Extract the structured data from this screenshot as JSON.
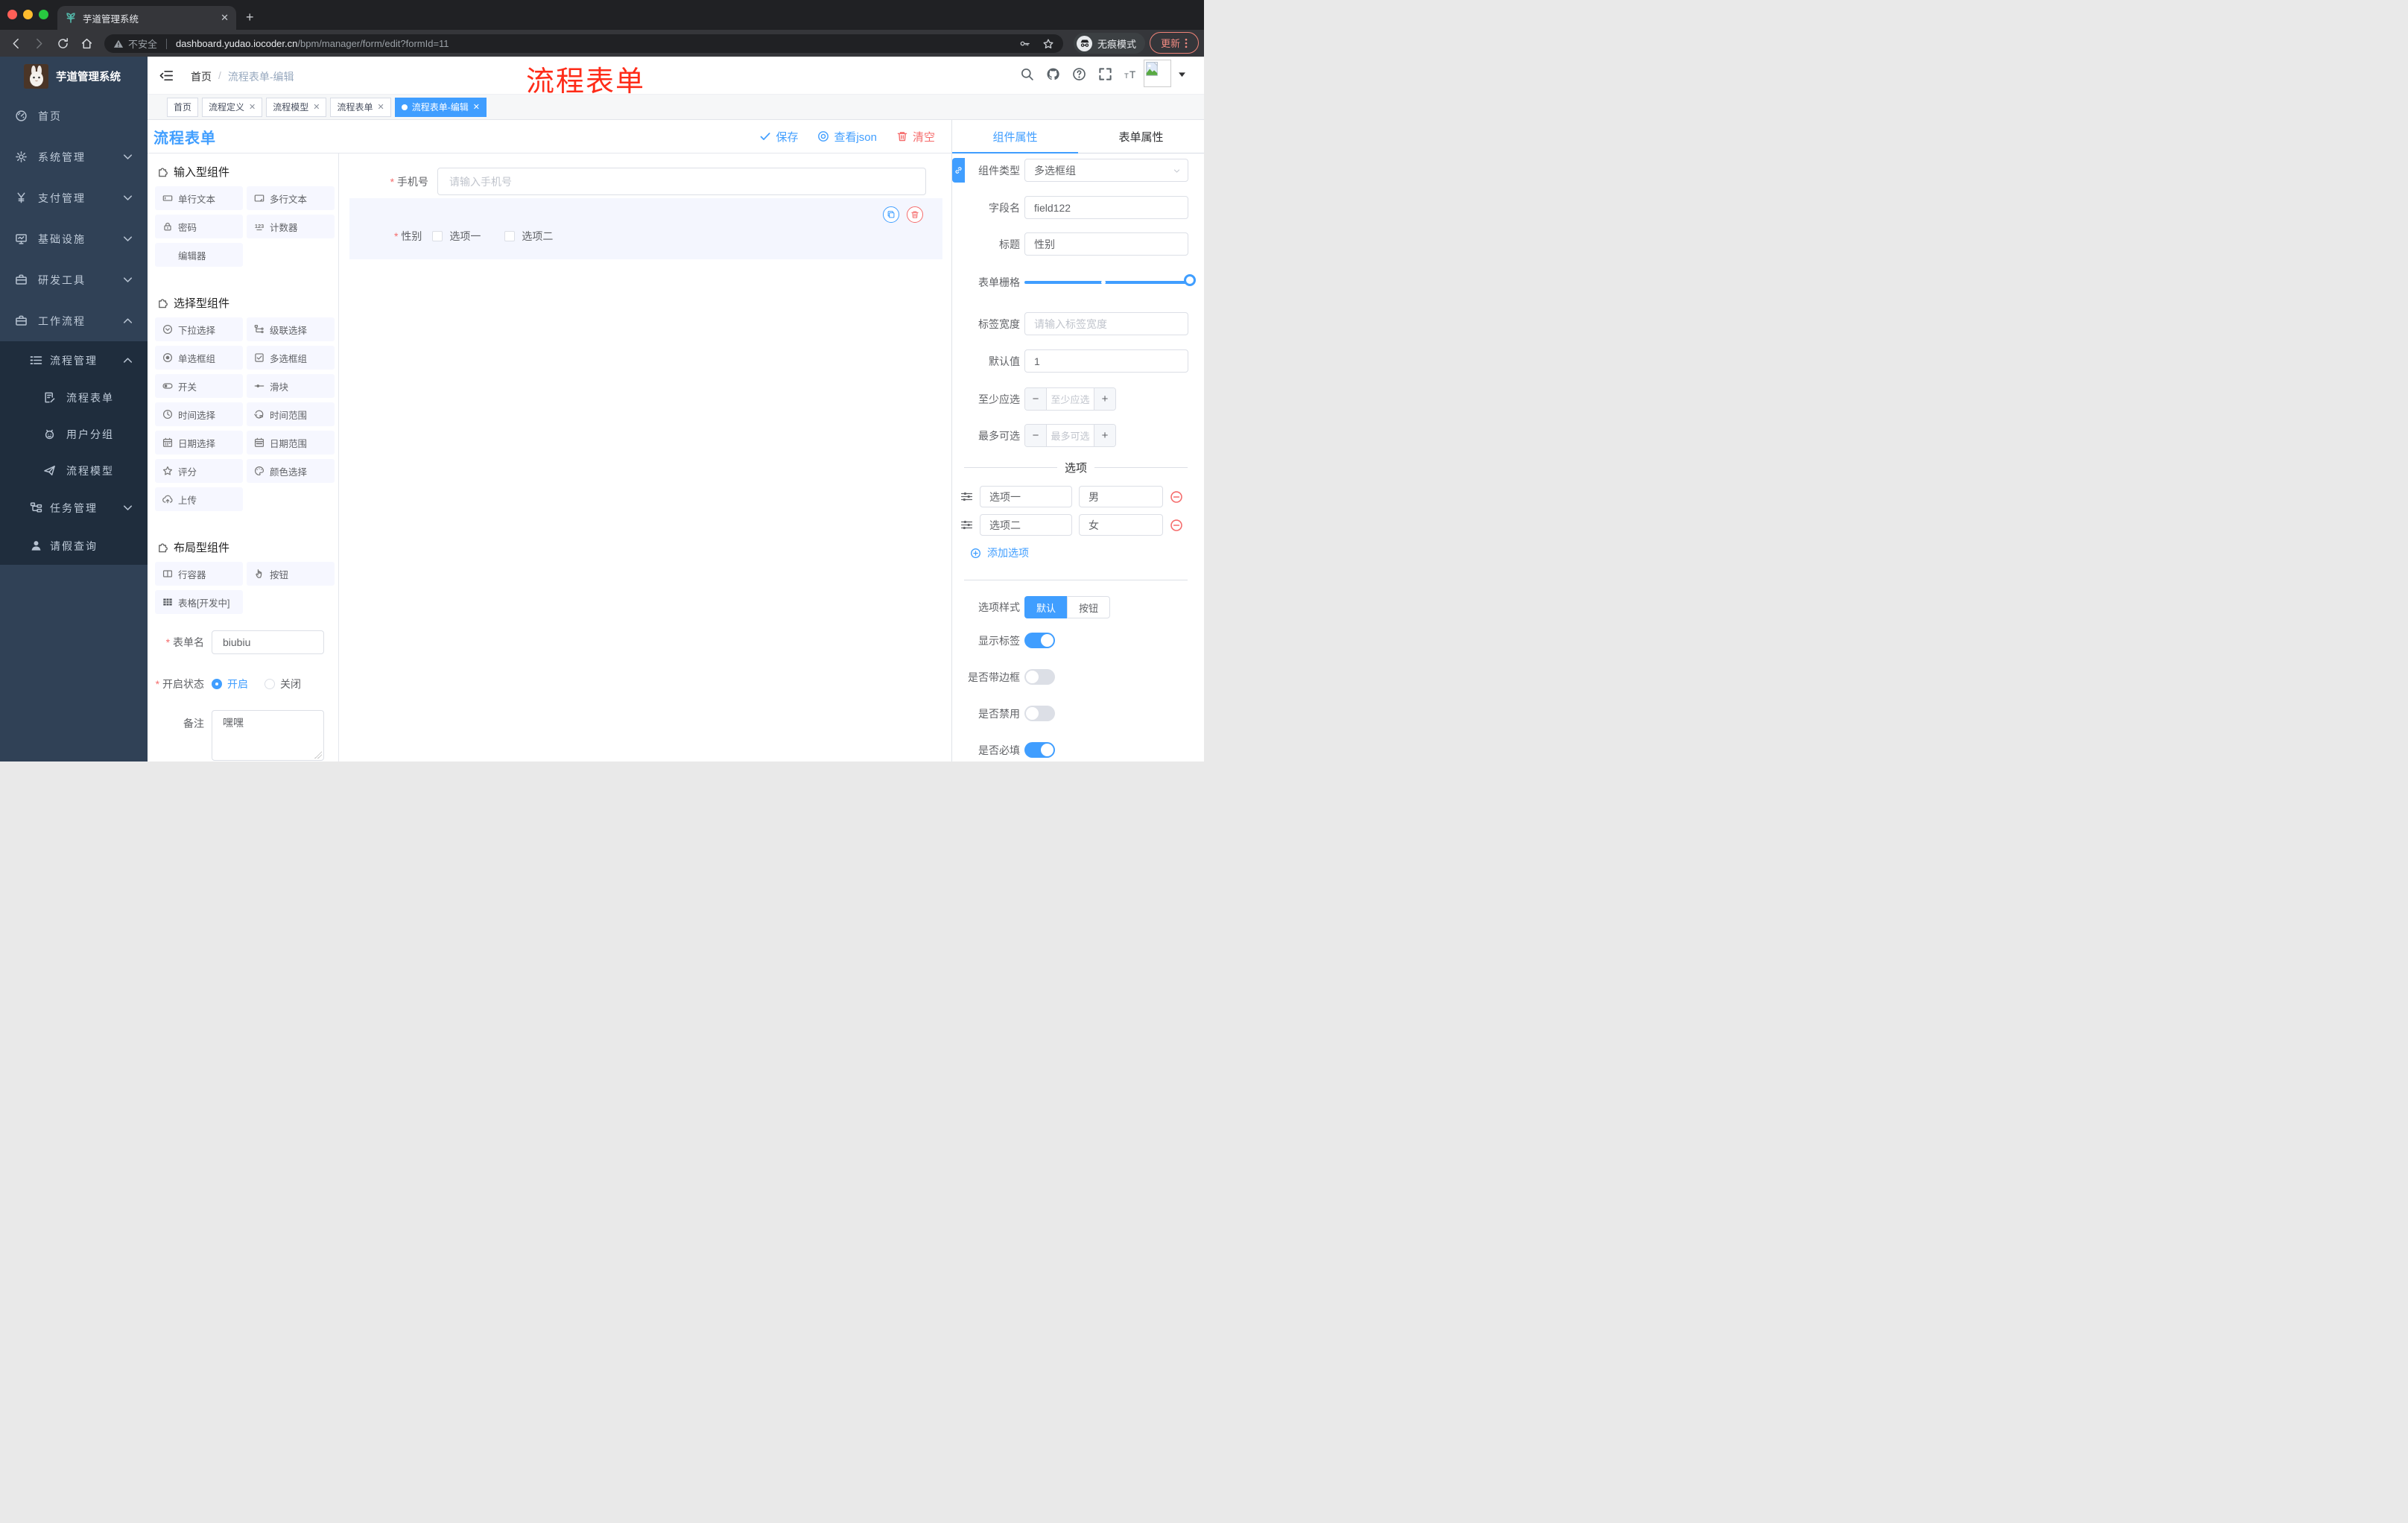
{
  "browser": {
    "tab_title": "芋道管理系统",
    "security_label": "不安全",
    "url_domain": "dashboard.yudao.iocoder.cn",
    "url_path": "/bpm/manager/form/edit?formId=11",
    "incognito_label": "无痕模式",
    "update_label": "更新"
  },
  "sidebar": {
    "logo_title": "芋道管理系统",
    "items": [
      {
        "label": "首页",
        "icon": "dashboard",
        "level": 1,
        "chevron": ""
      },
      {
        "label": "系统管理",
        "icon": "gear",
        "level": 1,
        "chevron": "down"
      },
      {
        "label": "支付管理",
        "icon": "yen",
        "level": 1,
        "chevron": "down"
      },
      {
        "label": "基础设施",
        "icon": "monitor",
        "level": 1,
        "chevron": "down"
      },
      {
        "label": "研发工具",
        "icon": "briefcase",
        "level": 1,
        "chevron": "down"
      },
      {
        "label": "工作流程",
        "icon": "briefcase",
        "level": 1,
        "chevron": "up"
      },
      {
        "label": "流程管理",
        "icon": "listtree",
        "level": 2,
        "chevron": "up"
      },
      {
        "label": "流程表单",
        "icon": "docedit",
        "level": 3,
        "chevron": ""
      },
      {
        "label": "用户分组",
        "icon": "robot",
        "level": 3,
        "chevron": ""
      },
      {
        "label": "流程模型",
        "icon": "plane",
        "level": 3,
        "chevron": ""
      },
      {
        "label": "任务管理",
        "icon": "tree",
        "level": 2,
        "chevron": "down"
      },
      {
        "label": "请假查询",
        "icon": "person",
        "level": 2,
        "chevron": ""
      }
    ]
  },
  "header": {
    "breadcrumb_home": "首页",
    "breadcrumb_current": "流程表单-编辑",
    "annotation": "流程表单",
    "annotation_color": "#fe2b18"
  },
  "tags": [
    {
      "label": "首页",
      "closable": false,
      "active": false
    },
    {
      "label": "流程定义",
      "closable": true,
      "active": false
    },
    {
      "label": "流程模型",
      "closable": true,
      "active": false
    },
    {
      "label": "流程表单",
      "closable": true,
      "active": false
    },
    {
      "label": "流程表单-编辑",
      "closable": true,
      "active": true
    }
  ],
  "designer": {
    "title": "流程表单",
    "toolbar": {
      "save": "保存",
      "view_json": "查看json",
      "clear": "清空"
    },
    "sections": [
      {
        "title": "输入型组件",
        "items": [
          {
            "icon": "input",
            "label": "单行文本"
          },
          {
            "icon": "textarea",
            "label": "多行文本"
          },
          {
            "icon": "lock",
            "label": "密码"
          },
          {
            "icon": "counter",
            "label": "计数器"
          },
          {
            "icon": "",
            "label": "编辑器"
          }
        ]
      },
      {
        "title": "选择型组件",
        "items": [
          {
            "icon": "select",
            "label": "下拉选择"
          },
          {
            "icon": "cascade",
            "label": "级联选择"
          },
          {
            "icon": "radio",
            "label": "单选框组"
          },
          {
            "icon": "checkbox",
            "label": "多选框组"
          },
          {
            "icon": "switch",
            "label": "开关"
          },
          {
            "icon": "slider",
            "label": "滑块"
          },
          {
            "icon": "time",
            "label": "时间选择"
          },
          {
            "icon": "timerange",
            "label": "时间范围"
          },
          {
            "icon": "date",
            "label": "日期选择"
          },
          {
            "icon": "daterange",
            "label": "日期范围"
          },
          {
            "icon": "star",
            "label": "评分"
          },
          {
            "icon": "palette",
            "label": "颜色选择"
          },
          {
            "icon": "upload",
            "label": "上传"
          }
        ]
      },
      {
        "title": "布局型组件",
        "items": [
          {
            "icon": "columns",
            "label": "行容器"
          },
          {
            "icon": "pointer",
            "label": "按钮"
          },
          {
            "icon": "table",
            "label": "表格[开发中]"
          }
        ]
      }
    ],
    "footer": {
      "form_name_label": "表单名",
      "form_name_value": "biubiu",
      "status_label": "开启状态",
      "status_on": "开启",
      "status_off": "关闭",
      "remark_label": "备注",
      "remark_value": "嘿嘿"
    }
  },
  "canvas": {
    "phone_label": "手机号",
    "phone_placeholder": "请输入手机号",
    "gender_label": "性别",
    "gender_options": [
      "选项一",
      "选项二"
    ]
  },
  "panel": {
    "tab_component": "组件属性",
    "tab_form": "表单属性",
    "component_type_label": "组件类型",
    "component_type_value": "多选框组",
    "field_name_label": "字段名",
    "field_name_value": "field122",
    "title_label": "标题",
    "title_value": "性别",
    "grid_label": "表单栅格",
    "label_width_label": "标签宽度",
    "label_width_placeholder": "请输入标签宽度",
    "default_label": "默认值",
    "default_value": "1",
    "min_label": "至少应选",
    "min_placeholder": "至少应选",
    "max_label": "最多可选",
    "max_placeholder": "最多可选",
    "options_divider": "选项",
    "options": [
      {
        "label": "选项一",
        "value": "男"
      },
      {
        "label": "选项二",
        "value": "女"
      }
    ],
    "add_option": "添加选项",
    "style_label": "选项样式",
    "style_options": [
      {
        "label": "默认",
        "active": true
      },
      {
        "label": "按钮",
        "active": false
      }
    ],
    "toggles": [
      {
        "label": "显示标签",
        "on": true
      },
      {
        "label": "是否带边框",
        "on": false
      },
      {
        "label": "是否禁用",
        "on": false
      },
      {
        "label": "是否必填",
        "on": true
      }
    ]
  }
}
